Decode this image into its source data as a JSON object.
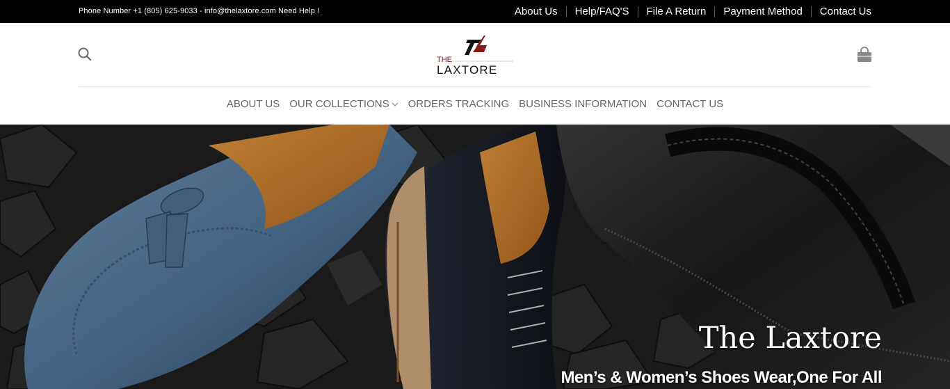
{
  "topbar": {
    "contact_text": "Phone Number +1 (805) 625-9033 - info@thelaxtore.com Need Help !",
    "links": [
      "About Us",
      "Help/FAQ'S",
      "File A Return",
      "Payment Method",
      "Contact Us"
    ]
  },
  "header": {
    "logo_text_small": "THE",
    "logo_text_main": "LAXTORE",
    "search_icon": "search-icon",
    "cart_icon": "shopping-bag-icon"
  },
  "mainnav": {
    "items": [
      "ABOUT US",
      "OUR COLLECTIONS",
      "ORDERS TRACKING",
      "BUSINESS INFORMATION",
      "CONTACT US"
    ],
    "dropdown_icon": "chevron-down-icon"
  },
  "hero": {
    "title": "The Laxtore",
    "subtitle": "Men’s & Women’s Shoes Wear,One For All"
  },
  "colors": {
    "topbar_bg": "#000000",
    "brand_red": "#8b1a1a",
    "nav_text": "#666666"
  }
}
